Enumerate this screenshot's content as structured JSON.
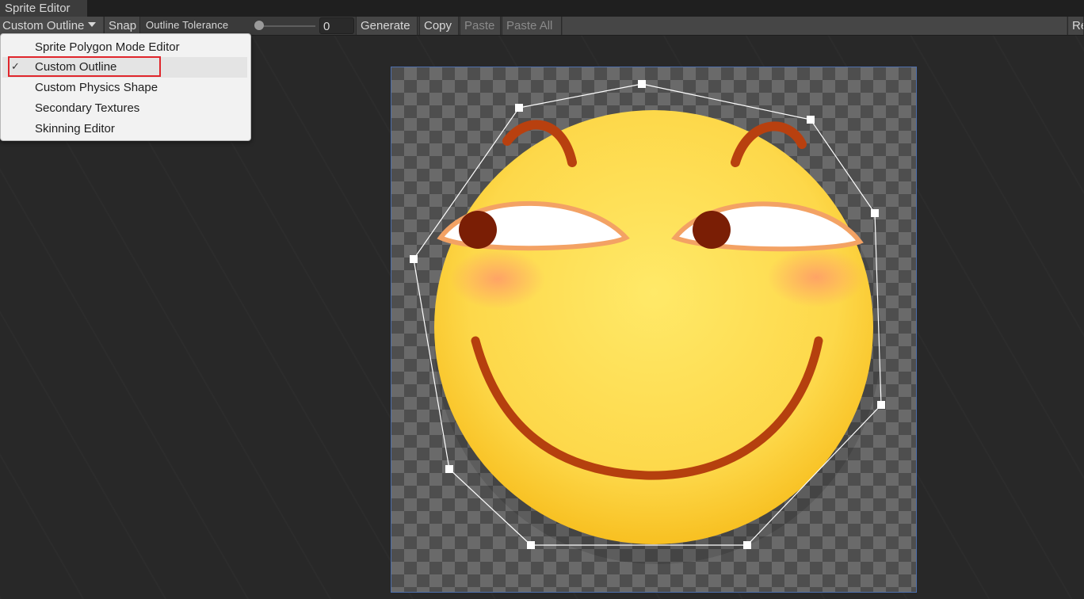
{
  "window": {
    "title": "Sprite Editor"
  },
  "toolbar": {
    "mode_label": "Custom Outline",
    "snap_label": "Snap",
    "tolerance_label": "Outline Tolerance",
    "tolerance_value": "0",
    "tolerance_slider_fraction": 0,
    "generate_label": "Generate",
    "copy_label": "Copy",
    "paste_label": "Paste",
    "paste_all_label": "Paste All",
    "revert_label": "Re"
  },
  "mode_menu": {
    "items": [
      {
        "label": "Sprite Polygon Mode Editor",
        "checked": false
      },
      {
        "label": "Custom Outline",
        "checked": true
      },
      {
        "label": "Custom Physics Shape",
        "checked": false
      },
      {
        "label": "Secondary Textures",
        "checked": false
      },
      {
        "label": "Skinning Editor",
        "checked": false
      }
    ],
    "check_glyph": "✓",
    "highlight_color": "#e0262c"
  },
  "canvas": {
    "frame_color": "#4d6fae",
    "checker_light": "#6a6a6a",
    "checker_dark": "#4e4e4e",
    "outline_color": "#ffffff",
    "sprite": {
      "subject": "smiling-emoji-face",
      "face_color": "#fdd84a",
      "brow_color": "#b8400f",
      "eye_color": "#7a1e05",
      "blush_color": "#ff9a6a"
    }
  }
}
